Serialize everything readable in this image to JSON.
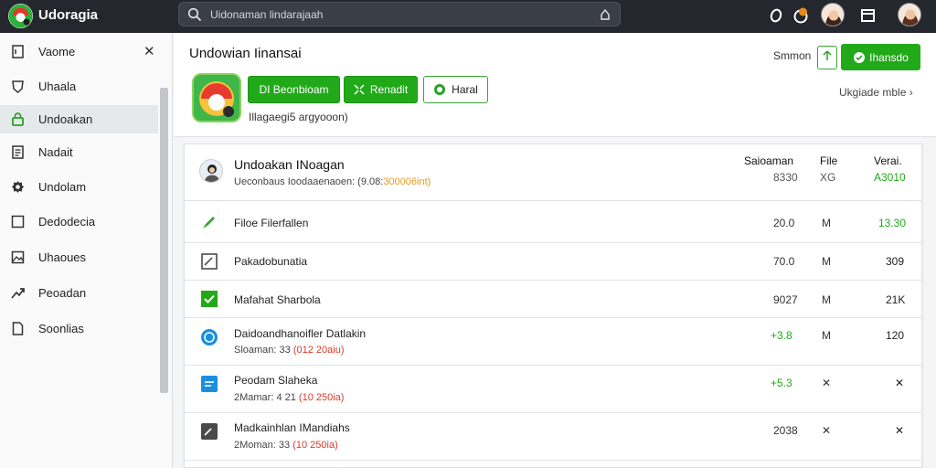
{
  "app": {
    "title": "Udoragia"
  },
  "search": {
    "value": "Uidonaman lindarajaah"
  },
  "sidebar": {
    "items": [
      {
        "label": "Vaome",
        "icon": "file-icon"
      },
      {
        "label": "Uhaala",
        "icon": "shield-icon"
      },
      {
        "label": "Undoakan",
        "icon": "lock-icon"
      },
      {
        "label": "Nadait",
        "icon": "document-icon"
      },
      {
        "label": "Undolam",
        "icon": "gear-icon"
      },
      {
        "label": "Dedodecia",
        "icon": "square-icon"
      },
      {
        "label": "Uhaoues",
        "icon": "image-icon"
      },
      {
        "label": "Peoadan",
        "icon": "arrow-icon"
      },
      {
        "label": "Soonlias",
        "icon": "page-icon"
      }
    ],
    "close_label": "✕"
  },
  "header": {
    "title": "Undowian Iinansai",
    "buttons": [
      {
        "label": "DI Beonbioam"
      },
      {
        "label": "Renadit"
      },
      {
        "label": "Haral"
      }
    ],
    "sub_info": "Illagaegi5 argyooon)",
    "sort_label": "Smmon",
    "primary_label": "Ihansdo",
    "upgrade_label": "Ukgiade mble ›"
  },
  "list": {
    "head": {
      "title": "Undoakan INoagan",
      "sub_prefix": "Ueconbaus Ioodaaenaoen: (9.08:",
      "sub_highlight": "300006int)",
      "cols": [
        {
          "name": "Saioaman",
          "value": "8330"
        },
        {
          "name": "File",
          "value": "XG"
        },
        {
          "name": "Verai.",
          "value": "A3010"
        }
      ]
    },
    "rows": [
      {
        "title": "Filoe Filerfallen",
        "sub_prefix": "",
        "sub_highlight": "",
        "c1": "20.0",
        "c2": "M",
        "c3": "13.30",
        "c1_green": false,
        "c3_green": true
      },
      {
        "title": "Pakadobunatia",
        "sub_prefix": "",
        "sub_highlight": "",
        "c1": "70.0",
        "c2": "M",
        "c3": "309",
        "c1_green": false,
        "c3_green": false
      },
      {
        "title": "Mafahat Sharbola",
        "sub_prefix": "",
        "sub_highlight": "",
        "c1": "9027",
        "c2": "M",
        "c3": "21K",
        "c1_green": false,
        "c3_green": false
      },
      {
        "title": "Daidoandhanoifler Datlakin",
        "sub_prefix": "Sloaman: 33 ",
        "sub_highlight": "(012 20aiu)",
        "c1": "+3.8",
        "c2": "M",
        "c3": "120",
        "c1_green": true,
        "c3_green": false
      },
      {
        "title": "Peodam Slaheka",
        "sub_prefix": "2Mamar: 4 21 ",
        "sub_highlight": "(10 250ia)",
        "c1": "+5.3",
        "c2": "✕",
        "c3": "✕",
        "c1_green": true,
        "c3_green": false
      },
      {
        "title": "Madkainhlan IMandiahs",
        "sub_prefix": "2Moman: 33 ",
        "sub_highlight": "(10 250ia)",
        "c1": "2038",
        "c2": "✕",
        "c3": "✕",
        "c1_green": false,
        "c3_green": false
      }
    ]
  }
}
